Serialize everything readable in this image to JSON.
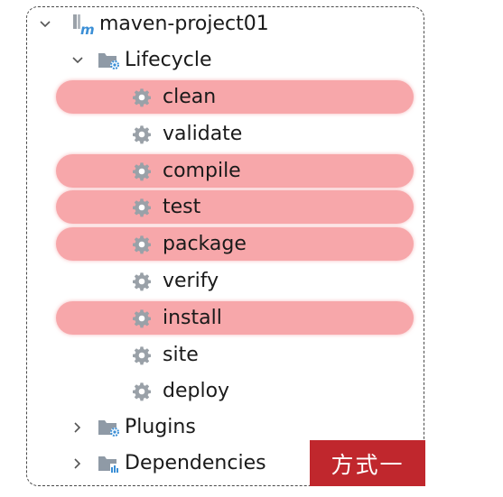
{
  "tree": {
    "project": {
      "label": "maven-project01",
      "icon": "maven-module-icon",
      "expanded": true
    },
    "lifecycle": {
      "label": "Lifecycle",
      "icon": "folder-gear-icon",
      "expanded": true,
      "phases": [
        {
          "label": "clean",
          "highlighted": true
        },
        {
          "label": "validate",
          "highlighted": false
        },
        {
          "label": "compile",
          "highlighted": true
        },
        {
          "label": "test",
          "highlighted": true
        },
        {
          "label": "package",
          "highlighted": true
        },
        {
          "label": "verify",
          "highlighted": false
        },
        {
          "label": "install",
          "highlighted": true
        },
        {
          "label": "site",
          "highlighted": false
        },
        {
          "label": "deploy",
          "highlighted": false
        }
      ]
    },
    "plugins": {
      "label": "Plugins",
      "icon": "folder-gear-icon",
      "expanded": false
    },
    "dependencies": {
      "label": "Dependencies",
      "icon": "folder-chart-icon",
      "expanded": false
    }
  },
  "badge": {
    "label": "方式一"
  },
  "colors": {
    "highlight": "#f7a7aa",
    "badge": "#c0272d",
    "gear": "#9aa1a8",
    "folder": "#8f9aa6",
    "accent": "#3b8fd6"
  }
}
